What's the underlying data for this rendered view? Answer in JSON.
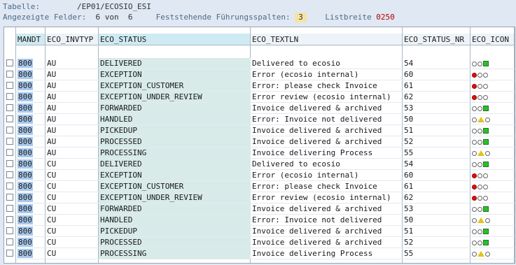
{
  "header": {
    "table_label": "Tabelle:",
    "table_value": "/EP01/ECOSIO_ESI",
    "fields_label": "Angezeigte Felder:",
    "fields_value": "6 von  6",
    "fixed_label": "Feststehende Führungsspalten:",
    "fixed_value": "3",
    "width_label": "Listbreite",
    "width_value": "0250"
  },
  "columns": [
    "MANDT",
    "ECO_INVTYP",
    "ECO_STATUS",
    "ECO_TEXTLN",
    "ECO_STATUS_NR",
    "ECO_ICON"
  ],
  "rows": [
    {
      "mandt": "800",
      "invtyp": "AU",
      "status": "DELIVERED",
      "text": "Delivered to ecosio",
      "nr": "54",
      "icon": "green"
    },
    {
      "mandt": "800",
      "invtyp": "AU",
      "status": "EXCEPTION",
      "text": "Error (ecosio internal)",
      "nr": "60",
      "icon": "red"
    },
    {
      "mandt": "800",
      "invtyp": "AU",
      "status": "EXCEPTION_CUSTOMER",
      "text": "Error: please check Invoice",
      "nr": "61",
      "icon": "red"
    },
    {
      "mandt": "800",
      "invtyp": "AU",
      "status": "EXCEPTION_UNDER_REVIEW",
      "text": "Error review (ecosio internal)",
      "nr": "62",
      "icon": "red"
    },
    {
      "mandt": "800",
      "invtyp": "AU",
      "status": "FORWARDED",
      "text": "Invoice delivered & archived",
      "nr": "53",
      "icon": "green"
    },
    {
      "mandt": "800",
      "invtyp": "AU",
      "status": "HANDLED",
      "text": "Error: Invoice not delivered",
      "nr": "50",
      "icon": "yellow"
    },
    {
      "mandt": "800",
      "invtyp": "AU",
      "status": "PICKEDUP",
      "text": "Invoice delivered & archived",
      "nr": "51",
      "icon": "green"
    },
    {
      "mandt": "800",
      "invtyp": "AU",
      "status": "PROCESSED",
      "text": "Invoice delivered & archived",
      "nr": "52",
      "icon": "green"
    },
    {
      "mandt": "800",
      "invtyp": "AU",
      "status": "PROCESSING",
      "text": "Invoice delivering Process",
      "nr": "55",
      "icon": "yellow"
    },
    {
      "mandt": "800",
      "invtyp": "CU",
      "status": "DELIVERED",
      "text": "Delivered to ecosio",
      "nr": "54",
      "icon": "green"
    },
    {
      "mandt": "800",
      "invtyp": "CU",
      "status": "EXCEPTION",
      "text": "Error (ecosio internal)",
      "nr": "60",
      "icon": "red"
    },
    {
      "mandt": "800",
      "invtyp": "CU",
      "status": "EXCEPTION_CUSTOMER",
      "text": "Error: please check Invoice",
      "nr": "61",
      "icon": "red"
    },
    {
      "mandt": "800",
      "invtyp": "CU",
      "status": "EXCEPTION_UNDER_REVIEW",
      "text": "Error review (ecosio internal)",
      "nr": "62",
      "icon": "red"
    },
    {
      "mandt": "800",
      "invtyp": "CU",
      "status": "FORWARDED",
      "text": "Invoice delivered & archived",
      "nr": "53",
      "icon": "green"
    },
    {
      "mandt": "800",
      "invtyp": "CU",
      "status": "HANDLED",
      "text": "Error: Invoice not delivered",
      "nr": "50",
      "icon": "yellow"
    },
    {
      "mandt": "800",
      "invtyp": "CU",
      "status": "PICKEDUP",
      "text": "Invoice delivered & archived",
      "nr": "51",
      "icon": "green"
    },
    {
      "mandt": "800",
      "invtyp": "CU",
      "status": "PROCESSED",
      "text": "Invoice delivered & archived",
      "nr": "52",
      "icon": "green"
    },
    {
      "mandt": "800",
      "invtyp": "CU",
      "status": "PROCESSING",
      "text": "Invoice delivering Process",
      "nr": "55",
      "icon": "yellow"
    }
  ],
  "colors": {
    "header_label": "#4e6a87",
    "list_width_value": "#b00000",
    "key_column_bg": "#d8ebe9",
    "mandt_highlight": "#a7c8ec",
    "fixed_badge": "#f6e3a2"
  }
}
